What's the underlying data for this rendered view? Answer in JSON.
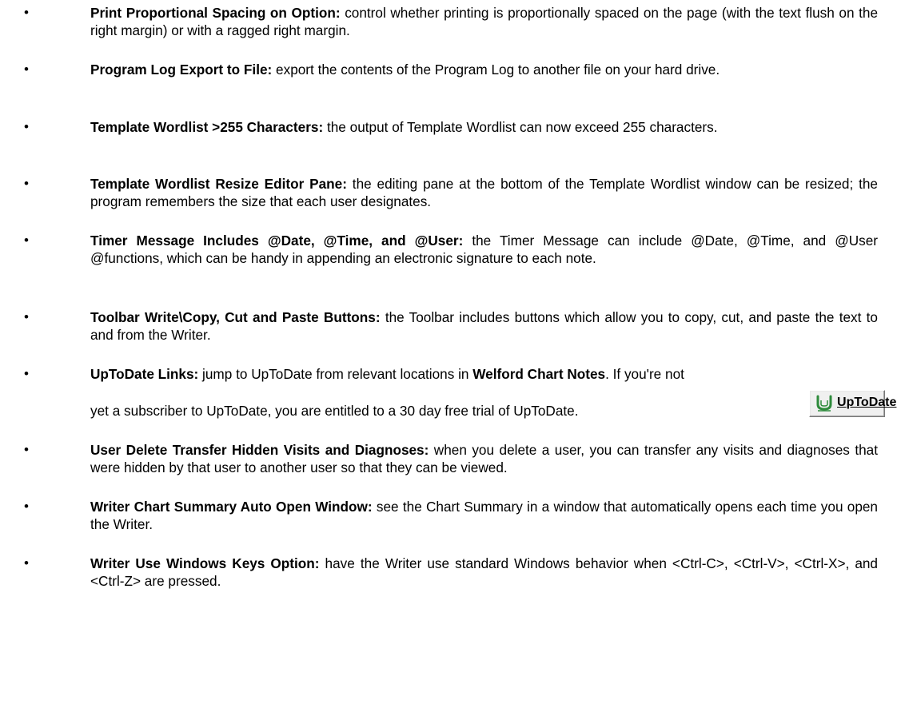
{
  "items": [
    {
      "title": "Print Proportional Spacing on Option:",
      "text": " control whether printing is proportionally spaced on the page (with the text flush on the right margin) or with a ragged right margin."
    },
    {
      "title": "Program Log Export to File:",
      "text": " export the contents of the Program Log to another file on your hard drive."
    },
    {
      "title": "Template Wordlist >255 Characters:",
      "text": " the output of Template Wordlist can now exceed 255 characters."
    },
    {
      "title": "Template Wordlist Resize Editor Pane:",
      "text": " the editing pane at the bottom of the Template Wordlist window can be resized; the program remembers the size that each user designates."
    },
    {
      "title": "Timer Message Includes @Date, @Time, and @User:",
      "text": " the Timer Message can include @Date, @Time, and @User @functions, which can be handy in appending an electronic signature to each note."
    },
    {
      "title": "Toolbar Write\\Copy, Cut and Paste Buttons:",
      "text": " the Toolbar includes buttons which allow you to copy, cut, and paste the text to and from the Writer."
    },
    {
      "title": "UpToDate Links:",
      "text_a": " jump to UpToDate from relevant locations in ",
      "product": "Welford Chart Notes",
      "text_b": ". If you're not",
      "text_c": "yet a subscriber to UpToDate, you are entitled to a 30 day free trial of UpToDate.",
      "button_label_first": "U",
      "button_label_rest": "pToDate",
      "button_icon": "uptodate-u-icon"
    },
    {
      "title": "User Delete Transfer Hidden Visits and Diagnoses:",
      "text": " when you delete a user, you can transfer any visits and diagnoses that were hidden by that user to another user so that they can be viewed."
    },
    {
      "title": "Writer Chart Summary Auto Open Window:",
      "text": " see the Chart Summary in a window that automatically opens each time you open the Writer."
    },
    {
      "title": "Writer Use Windows Keys Option:",
      "text": " have the Writer use standard Windows behavior when <Ctrl-C>, <Ctrl-V>, <Ctrl-X>, and <Ctrl-Z> are pressed."
    }
  ],
  "bullet": "•",
  "colors": {
    "text": "#000000",
    "background": "#ffffff",
    "icon_green": "#2e8b3c"
  }
}
